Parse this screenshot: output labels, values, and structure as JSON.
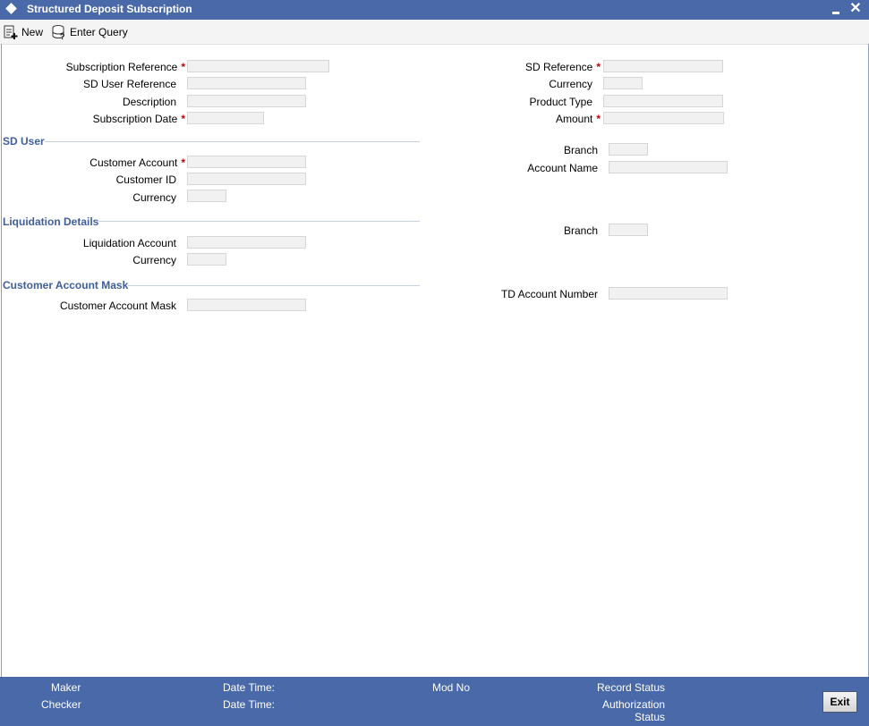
{
  "window": {
    "title": "Structured Deposit Subscription"
  },
  "toolbar": {
    "new_label": "New",
    "enter_query_label": "Enter Query"
  },
  "left_fields": {
    "subscription_reference": "Subscription Reference",
    "sd_user_reference": "SD User Reference",
    "description": "Description",
    "subscription_date": "Subscription Date"
  },
  "right_fields": {
    "sd_reference": "SD Reference",
    "currency": "Currency",
    "product_type": "Product Type",
    "amount": "Amount"
  },
  "sd_user": {
    "title": "SD User",
    "customer_account": "Customer Account",
    "customer_id": "Customer ID",
    "currency": "Currency",
    "branch": "Branch",
    "account_name": "Account Name"
  },
  "liquidation": {
    "title": "Liquidation Details",
    "liquidation_account": "Liquidation Account",
    "currency": "Currency",
    "branch": "Branch"
  },
  "mask": {
    "title": "Customer Account Mask",
    "customer_account_mask": "Customer Account Mask",
    "td_account_number": "TD Account Number"
  },
  "required_marker": "*",
  "footer": {
    "maker": "Maker",
    "checker": "Checker",
    "date_time_1": "Date Time:",
    "date_time_2": "Date Time:",
    "mod_no": "Mod No",
    "record_status": "Record Status",
    "authorization_status_1": "Authorization",
    "authorization_status_2": "Status",
    "exit_label": "Exit"
  }
}
